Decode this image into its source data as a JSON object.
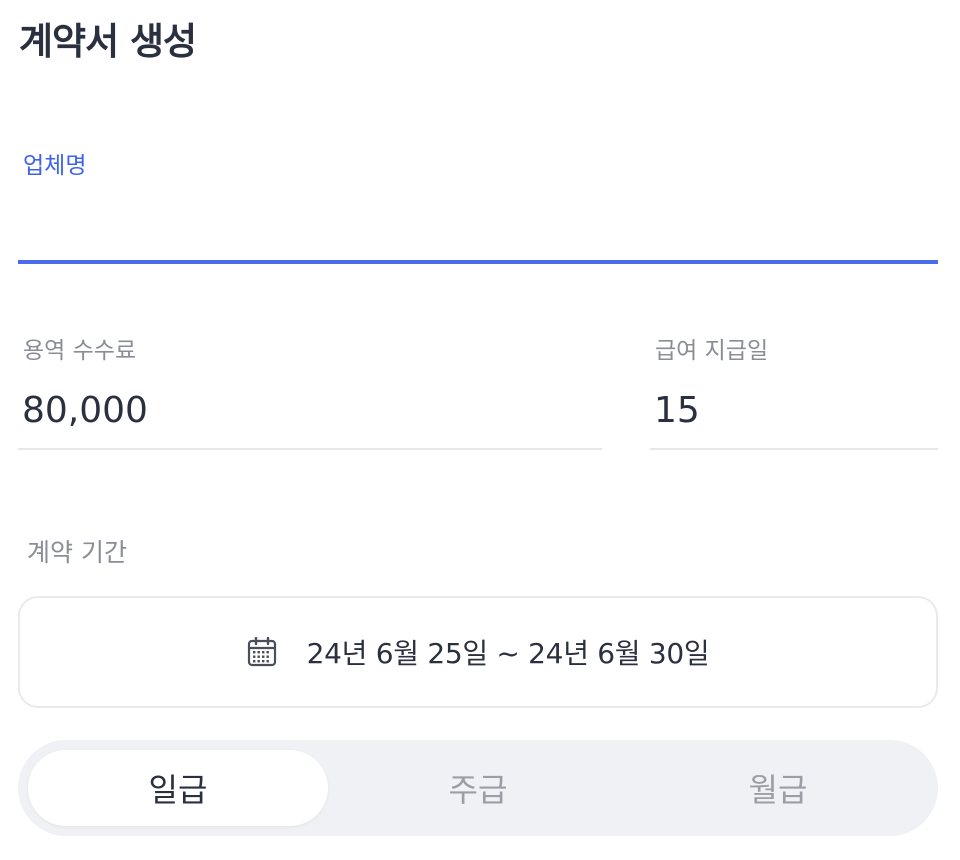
{
  "page": {
    "title": "계약서 생성"
  },
  "form": {
    "company": {
      "label": "업체명",
      "value": ""
    },
    "service_fee": {
      "label": "용역 수수료",
      "value": "80,000"
    },
    "pay_day": {
      "label": "급여 지급일",
      "value": "15"
    },
    "period": {
      "label": "계약 기간",
      "value": "24년 6월 25일 ~ 24년 6월 30일",
      "icon": "calendar-icon"
    },
    "pay_type": {
      "options": [
        "일급",
        "주급",
        "월급"
      ],
      "selected": "일급"
    }
  },
  "colors": {
    "accent": "#4a6ce8",
    "text": "#2b3040",
    "muted": "#8a8d96"
  }
}
